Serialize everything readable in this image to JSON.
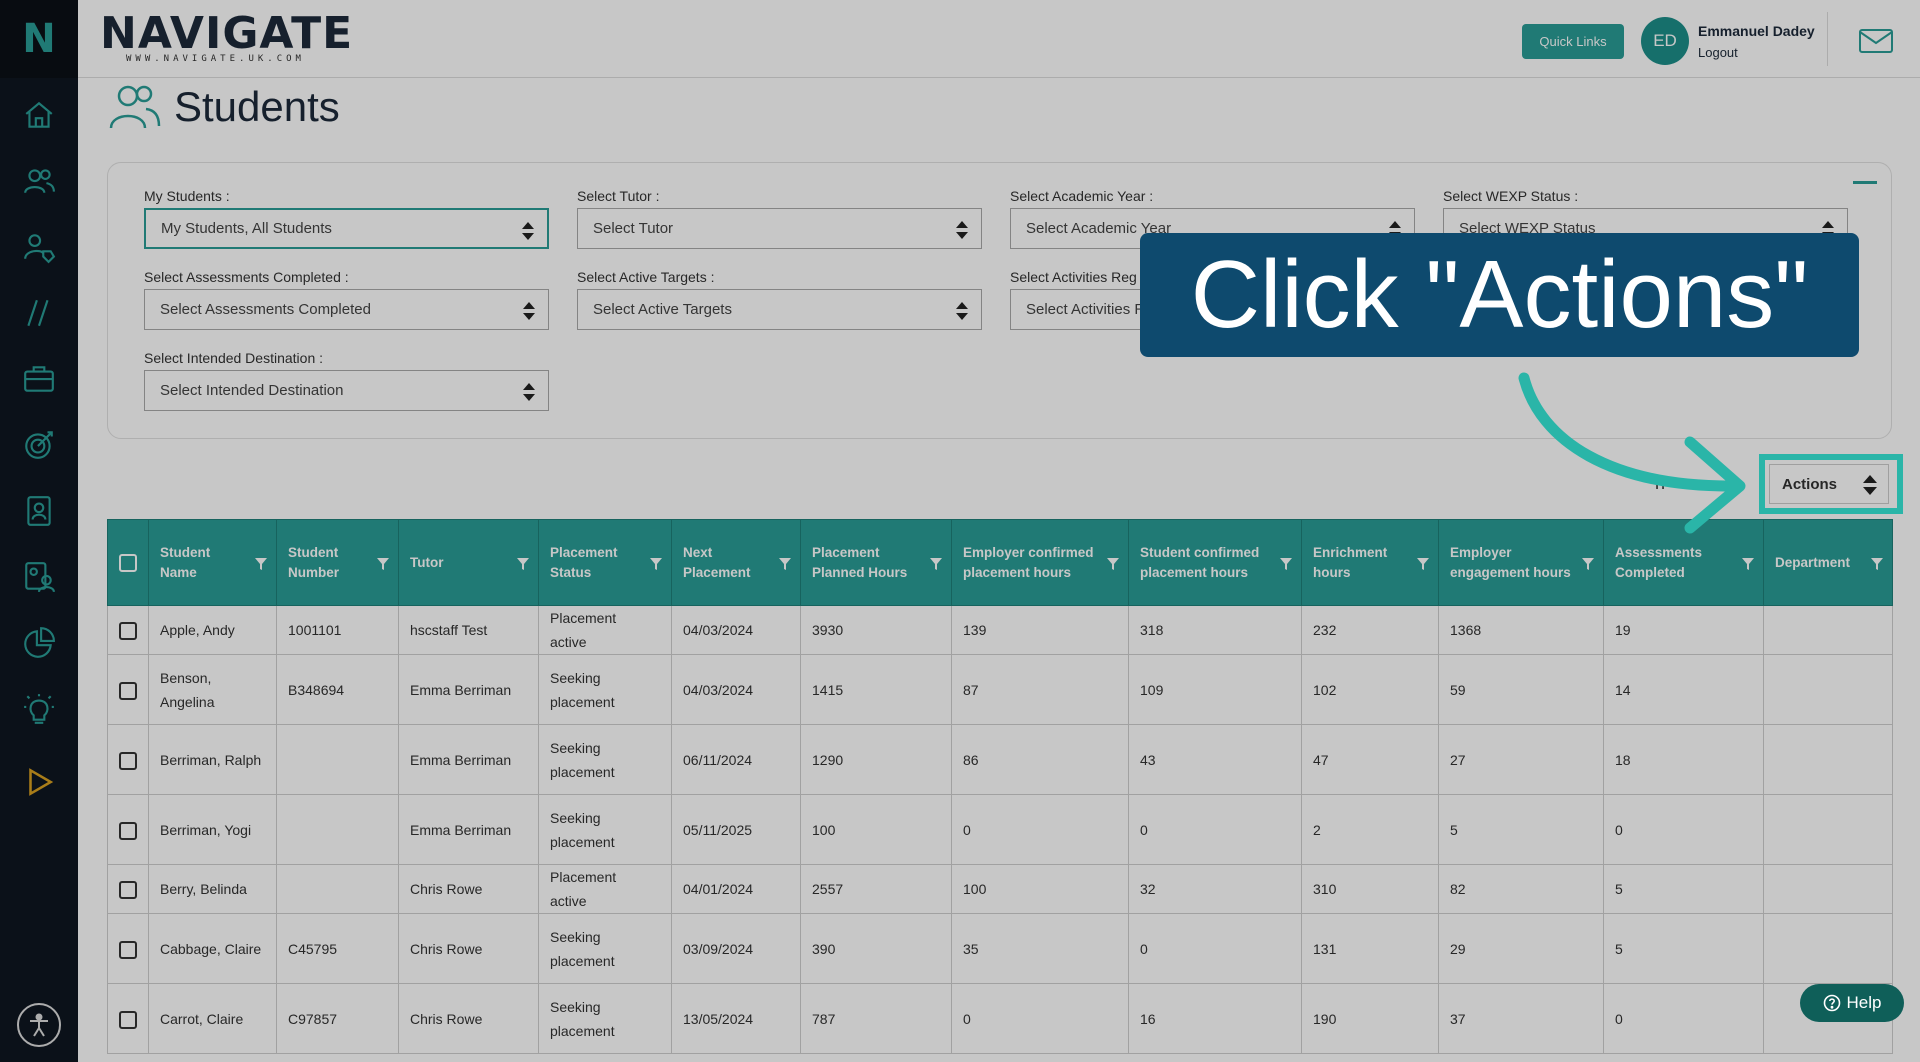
{
  "app": {
    "brand_name": "NAVIGATE",
    "brand_url": "WWW.NAVIGATE.UK.COM",
    "side_logo": "N"
  },
  "header": {
    "quick_links_label": "Quick Links",
    "avatar_initials": "ED",
    "user_name": "Emmanuel Dadey",
    "logout_label": "Logout",
    "mail_icon": "envelope-icon"
  },
  "sidebar": {
    "icons": [
      "home-icon",
      "students-icon",
      "user-tag-icon",
      "lines-icon",
      "briefcase-icon",
      "target-icon",
      "contact-card-icon",
      "team-icon",
      "pie-chart-icon",
      "lightbulb-icon",
      "play-icon"
    ]
  },
  "page": {
    "title": "Students"
  },
  "filters": {
    "my_students": {
      "label": "My Students :",
      "value": "My Students, All Students"
    },
    "tutor": {
      "label": "Select Tutor :",
      "value": "Select Tutor"
    },
    "academic_year": {
      "label": "Select Academic Year :",
      "value": "Select Academic Year"
    },
    "wexp_status": {
      "label": "Select WEXP Status :",
      "value": "Select WEXP Status"
    },
    "assessments": {
      "label": "Select Assessments Completed :",
      "value": "Select Assessments Completed"
    },
    "active_targets": {
      "label": "Select Active Targets :",
      "value": "Select Active Targets"
    },
    "activities": {
      "label": "Select Activities Reg",
      "value": "Select Activities R"
    },
    "destination": {
      "label": "Select Intended Destination :",
      "value": "Select Intended Destination"
    }
  },
  "toolbar": {
    "search_label": "h",
    "actions_label": "Actions"
  },
  "table": {
    "headers": [
      "Student Name",
      "Student Number",
      "Tutor",
      "Placement Status",
      "Next Placement",
      "Placement Planned Hours",
      "Employer confirmed placement hours",
      "Student confirmed placement hours",
      "Enrichment hours",
      "Employer engagement hours",
      "Assessments Completed",
      "Department"
    ],
    "rows": [
      [
        "Apple, Andy",
        "1001101",
        "hscstaff Test",
        "Placement active",
        "04/03/2024",
        "3930",
        "139",
        "318",
        "232",
        "1368",
        "19",
        ""
      ],
      [
        "Benson, Angelina",
        "B348694",
        "Emma Berriman",
        "Seeking placement",
        "04/03/2024",
        "1415",
        "87",
        "109",
        "102",
        "59",
        "14",
        ""
      ],
      [
        "Berriman, Ralph",
        "",
        "Emma Berriman",
        "Seeking placement",
        "06/11/2024",
        "1290",
        "86",
        "43",
        "47",
        "27",
        "18",
        ""
      ],
      [
        "Berriman, Yogi",
        "",
        "Emma Berriman",
        "Seeking placement",
        "05/11/2025",
        "100",
        "0",
        "0",
        "2",
        "5",
        "0",
        ""
      ],
      [
        "Berry, Belinda",
        "",
        "Chris Rowe",
        "Placement active",
        "04/01/2024",
        "2557",
        "100",
        "32",
        "310",
        "82",
        "5",
        ""
      ],
      [
        "Cabbage, Claire",
        "C45795",
        "Chris Rowe",
        "Seeking placement",
        "03/09/2024",
        "390",
        "35",
        "0",
        "131",
        "29",
        "5",
        ""
      ],
      [
        "Carrot, Claire",
        "C97857",
        "Chris Rowe",
        "Seeking placement",
        "13/05/2024",
        "787",
        "0",
        "16",
        "190",
        "37",
        "0",
        ""
      ]
    ]
  },
  "tutorial": {
    "callout_text": "Click \"Actions\""
  },
  "help": {
    "label": "Help"
  },
  "colors": {
    "teal": "#2a9d96",
    "callout_bg": "#0e4a6e",
    "highlight": "#2ab5a8",
    "sidebar_bg": "#0f1621"
  }
}
